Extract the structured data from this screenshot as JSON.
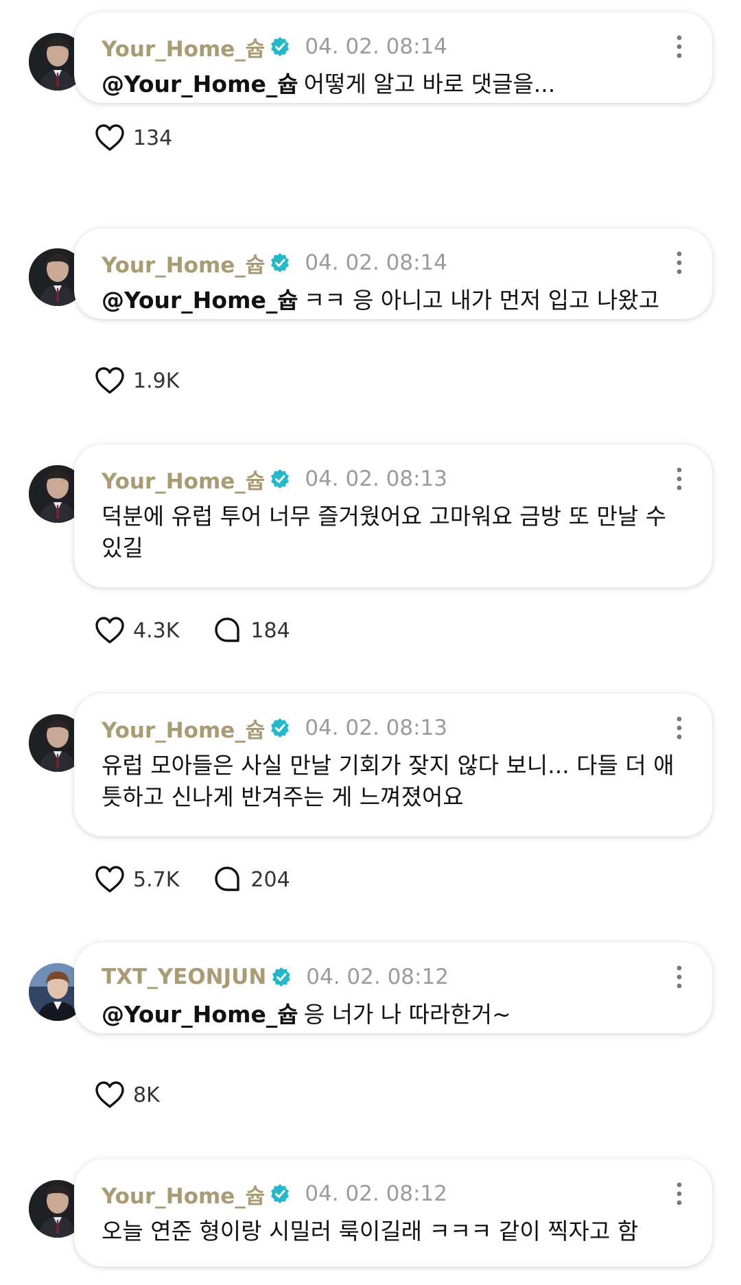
{
  "colors": {
    "author": "#a99b74",
    "timestamp": "#9b9b9b",
    "verified": "#25b8c9",
    "text": "#111111"
  },
  "comments": [
    {
      "author": "Your_Home_슙",
      "timestamp": "04. 02. 08:14",
      "mention": "@Your_Home_슙",
      "text": "어떻게 알고 바로 댓글을...",
      "likes": "134",
      "avatar_icon": "user-avatar-icon"
    },
    {
      "author": "Your_Home_슙",
      "timestamp": "04. 02. 08:14",
      "mention": "@Your_Home_슙",
      "text": "ㅋㅋ 응 아니고 내가 먼저 입고 나왔고",
      "likes": "1.9K",
      "avatar_icon": "user-avatar-icon"
    },
    {
      "author": "Your_Home_슙",
      "timestamp": "04. 02. 08:13",
      "mention": "",
      "text": "덕분에 유럽 투어 너무 즐거웠어요 고마워요 금방 또 만날 수 있길",
      "likes": "4.3K",
      "replies": "184",
      "avatar_icon": "user-avatar-icon"
    },
    {
      "author": "Your_Home_슙",
      "timestamp": "04. 02. 08:13",
      "mention": "",
      "text": "유럽 모아들은 사실 만날 기회가 잦지 않다 보니... 다들 더 애틋하고 신나게 반겨주는 게 느껴졌어요",
      "likes": "5.7K",
      "replies": "204",
      "avatar_icon": "user-avatar-icon"
    },
    {
      "author": "TXT_YEONJUN",
      "timestamp": "04. 02. 08:12",
      "mention": "@Your_Home_슙",
      "text": "응 너가 나 따라한거~",
      "likes": "8K",
      "avatar_icon": "user-avatar-icon"
    },
    {
      "author": "Your_Home_슙",
      "timestamp": "04. 02. 08:12",
      "mention": "",
      "text": "오늘 연준 형이랑 시밀러 룩이길래 ㅋㅋㅋ 같이 찍자고 함",
      "avatar_icon": "user-avatar-icon"
    }
  ]
}
